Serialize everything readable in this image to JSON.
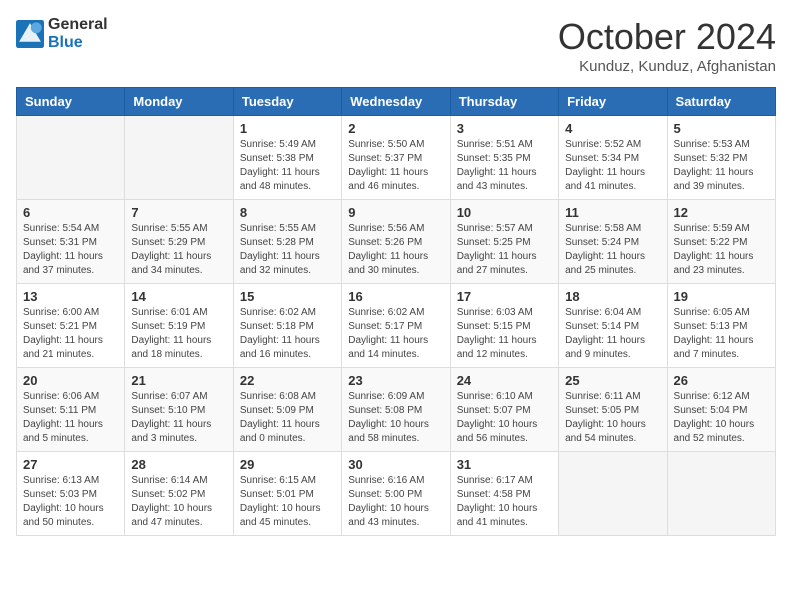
{
  "logo": {
    "line1": "General",
    "line2": "Blue"
  },
  "title": "October 2024",
  "location": "Kunduz, Kunduz, Afghanistan",
  "headers": [
    "Sunday",
    "Monday",
    "Tuesday",
    "Wednesday",
    "Thursday",
    "Friday",
    "Saturday"
  ],
  "weeks": [
    [
      {
        "day": "",
        "sunrise": "",
        "sunset": "",
        "daylight": ""
      },
      {
        "day": "",
        "sunrise": "",
        "sunset": "",
        "daylight": ""
      },
      {
        "day": "1",
        "sunrise": "Sunrise: 5:49 AM",
        "sunset": "Sunset: 5:38 PM",
        "daylight": "Daylight: 11 hours and 48 minutes."
      },
      {
        "day": "2",
        "sunrise": "Sunrise: 5:50 AM",
        "sunset": "Sunset: 5:37 PM",
        "daylight": "Daylight: 11 hours and 46 minutes."
      },
      {
        "day": "3",
        "sunrise": "Sunrise: 5:51 AM",
        "sunset": "Sunset: 5:35 PM",
        "daylight": "Daylight: 11 hours and 43 minutes."
      },
      {
        "day": "4",
        "sunrise": "Sunrise: 5:52 AM",
        "sunset": "Sunset: 5:34 PM",
        "daylight": "Daylight: 11 hours and 41 minutes."
      },
      {
        "day": "5",
        "sunrise": "Sunrise: 5:53 AM",
        "sunset": "Sunset: 5:32 PM",
        "daylight": "Daylight: 11 hours and 39 minutes."
      }
    ],
    [
      {
        "day": "6",
        "sunrise": "Sunrise: 5:54 AM",
        "sunset": "Sunset: 5:31 PM",
        "daylight": "Daylight: 11 hours and 37 minutes."
      },
      {
        "day": "7",
        "sunrise": "Sunrise: 5:55 AM",
        "sunset": "Sunset: 5:29 PM",
        "daylight": "Daylight: 11 hours and 34 minutes."
      },
      {
        "day": "8",
        "sunrise": "Sunrise: 5:55 AM",
        "sunset": "Sunset: 5:28 PM",
        "daylight": "Daylight: 11 hours and 32 minutes."
      },
      {
        "day": "9",
        "sunrise": "Sunrise: 5:56 AM",
        "sunset": "Sunset: 5:26 PM",
        "daylight": "Daylight: 11 hours and 30 minutes."
      },
      {
        "day": "10",
        "sunrise": "Sunrise: 5:57 AM",
        "sunset": "Sunset: 5:25 PM",
        "daylight": "Daylight: 11 hours and 27 minutes."
      },
      {
        "day": "11",
        "sunrise": "Sunrise: 5:58 AM",
        "sunset": "Sunset: 5:24 PM",
        "daylight": "Daylight: 11 hours and 25 minutes."
      },
      {
        "day": "12",
        "sunrise": "Sunrise: 5:59 AM",
        "sunset": "Sunset: 5:22 PM",
        "daylight": "Daylight: 11 hours and 23 minutes."
      }
    ],
    [
      {
        "day": "13",
        "sunrise": "Sunrise: 6:00 AM",
        "sunset": "Sunset: 5:21 PM",
        "daylight": "Daylight: 11 hours and 21 minutes."
      },
      {
        "day": "14",
        "sunrise": "Sunrise: 6:01 AM",
        "sunset": "Sunset: 5:19 PM",
        "daylight": "Daylight: 11 hours and 18 minutes."
      },
      {
        "day": "15",
        "sunrise": "Sunrise: 6:02 AM",
        "sunset": "Sunset: 5:18 PM",
        "daylight": "Daylight: 11 hours and 16 minutes."
      },
      {
        "day": "16",
        "sunrise": "Sunrise: 6:02 AM",
        "sunset": "Sunset: 5:17 PM",
        "daylight": "Daylight: 11 hours and 14 minutes."
      },
      {
        "day": "17",
        "sunrise": "Sunrise: 6:03 AM",
        "sunset": "Sunset: 5:15 PM",
        "daylight": "Daylight: 11 hours and 12 minutes."
      },
      {
        "day": "18",
        "sunrise": "Sunrise: 6:04 AM",
        "sunset": "Sunset: 5:14 PM",
        "daylight": "Daylight: 11 hours and 9 minutes."
      },
      {
        "day": "19",
        "sunrise": "Sunrise: 6:05 AM",
        "sunset": "Sunset: 5:13 PM",
        "daylight": "Daylight: 11 hours and 7 minutes."
      }
    ],
    [
      {
        "day": "20",
        "sunrise": "Sunrise: 6:06 AM",
        "sunset": "Sunset: 5:11 PM",
        "daylight": "Daylight: 11 hours and 5 minutes."
      },
      {
        "day": "21",
        "sunrise": "Sunrise: 6:07 AM",
        "sunset": "Sunset: 5:10 PM",
        "daylight": "Daylight: 11 hours and 3 minutes."
      },
      {
        "day": "22",
        "sunrise": "Sunrise: 6:08 AM",
        "sunset": "Sunset: 5:09 PM",
        "daylight": "Daylight: 11 hours and 0 minutes."
      },
      {
        "day": "23",
        "sunrise": "Sunrise: 6:09 AM",
        "sunset": "Sunset: 5:08 PM",
        "daylight": "Daylight: 10 hours and 58 minutes."
      },
      {
        "day": "24",
        "sunrise": "Sunrise: 6:10 AM",
        "sunset": "Sunset: 5:07 PM",
        "daylight": "Daylight: 10 hours and 56 minutes."
      },
      {
        "day": "25",
        "sunrise": "Sunrise: 6:11 AM",
        "sunset": "Sunset: 5:05 PM",
        "daylight": "Daylight: 10 hours and 54 minutes."
      },
      {
        "day": "26",
        "sunrise": "Sunrise: 6:12 AM",
        "sunset": "Sunset: 5:04 PM",
        "daylight": "Daylight: 10 hours and 52 minutes."
      }
    ],
    [
      {
        "day": "27",
        "sunrise": "Sunrise: 6:13 AM",
        "sunset": "Sunset: 5:03 PM",
        "daylight": "Daylight: 10 hours and 50 minutes."
      },
      {
        "day": "28",
        "sunrise": "Sunrise: 6:14 AM",
        "sunset": "Sunset: 5:02 PM",
        "daylight": "Daylight: 10 hours and 47 minutes."
      },
      {
        "day": "29",
        "sunrise": "Sunrise: 6:15 AM",
        "sunset": "Sunset: 5:01 PM",
        "daylight": "Daylight: 10 hours and 45 minutes."
      },
      {
        "day": "30",
        "sunrise": "Sunrise: 6:16 AM",
        "sunset": "Sunset: 5:00 PM",
        "daylight": "Daylight: 10 hours and 43 minutes."
      },
      {
        "day": "31",
        "sunrise": "Sunrise: 6:17 AM",
        "sunset": "Sunset: 4:58 PM",
        "daylight": "Daylight: 10 hours and 41 minutes."
      },
      {
        "day": "",
        "sunrise": "",
        "sunset": "",
        "daylight": ""
      },
      {
        "day": "",
        "sunrise": "",
        "sunset": "",
        "daylight": ""
      }
    ]
  ]
}
